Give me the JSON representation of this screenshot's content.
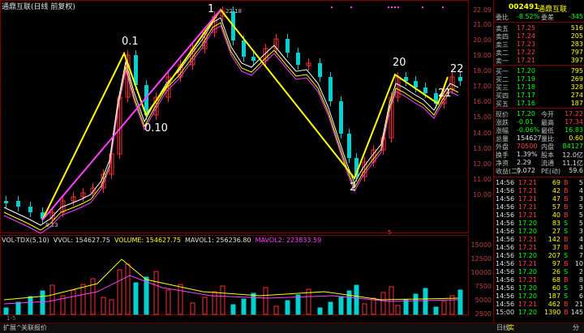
{
  "window": {
    "title": "通鼎互联(日线 前复权)"
  },
  "price_axis": [
    "22.09",
    "21.00",
    "20.00",
    "19.00",
    "18.00",
    "17.00",
    "16.00",
    "15.00",
    "14.00",
    "13.00",
    "12.00",
    "11.00",
    "10.00"
  ],
  "volume_axis": [
    "15000",
    "12500",
    "10000",
    "7500",
    "5000",
    "2500",
    "10000"
  ],
  "waves": [
    {
      "label": "1",
      "name": "wave-1"
    },
    {
      "label": "0.1",
      "name": "wave-0-1"
    },
    {
      "label": "0.10",
      "name": "wave-0-10"
    },
    {
      "label": "2",
      "name": "wave-2"
    },
    {
      "label": "20",
      "name": "wave-20"
    },
    {
      "label": "21",
      "name": "wave-21"
    },
    {
      "label": "22",
      "name": "wave-22"
    }
  ],
  "annotations": {
    "high": "22.18",
    "low": "8.13",
    "low2": "5"
  },
  "volume_legend": {
    "tdx": "VOL-TDX(5,10)",
    "vvol": "VVOL: 154627.75",
    "volume": "VOLUME: 154627.75",
    "mavol1": "MAVOL1: 256236.80",
    "mavol2": "MAVOL2: 223833.59"
  },
  "stock": {
    "code": "002491",
    "name": "通鼎互联"
  },
  "quote": {
    "weibi_label": "委比",
    "weibi": "-8.52%",
    "weicha_label": "委差",
    "weicha": "-345",
    "asks": [
      {
        "label": "卖五",
        "price": "17.25",
        "vol": "516"
      },
      {
        "label": "卖四",
        "price": "17.24",
        "vol": "205"
      },
      {
        "label": "卖三",
        "price": "17.23",
        "vol": "283"
      },
      {
        "label": "卖二",
        "price": "17.22",
        "vol": "797"
      },
      {
        "label": "卖一",
        "price": "17.21",
        "vol": "397"
      }
    ],
    "bids": [
      {
        "label": "买一",
        "price": "17.20",
        "vol": "795"
      },
      {
        "label": "买二",
        "price": "17.19",
        "vol": "269"
      },
      {
        "label": "买三",
        "price": "17.18",
        "vol": "328"
      },
      {
        "label": "买四",
        "price": "17.17",
        "vol": "274"
      },
      {
        "label": "买五",
        "price": "17.16",
        "vol": "187"
      }
    ],
    "stats": [
      {
        "l1": "现价",
        "v1": "17.20",
        "l2": "今开",
        "v2": "17.22",
        "c1": "green",
        "c2": "red"
      },
      {
        "l1": "涨跌",
        "v1": "-0.01",
        "l2": "最高",
        "v2": "17.34",
        "c1": "green",
        "c2": "red"
      },
      {
        "l1": "涨幅",
        "v1": "-0.06%",
        "l2": "最低",
        "v2": "16.83",
        "c1": "green",
        "c2": "green"
      },
      {
        "l1": "总量",
        "v1": "154627",
        "l2": "量比",
        "v2": "0.60",
        "c1": "white",
        "c2": "yellow"
      },
      {
        "l1": "外盘",
        "v1": "70500",
        "l2": "内盘",
        "v2": "84127",
        "c1": "red",
        "c2": "green"
      },
      {
        "l1": "换手",
        "v1": "1.39%",
        "l2": "股本",
        "v2": "12.0亿",
        "c1": "white",
        "c2": "white"
      },
      {
        "l1": "净资",
        "v1": "2.29",
        "l2": "流通",
        "v2": "11.1亿",
        "c1": "white",
        "c2": "white"
      },
      {
        "l1": "收益(二)",
        "v1": "0.072",
        "l2": "PE(动)",
        "v2": "59.6",
        "c1": "white",
        "c2": "white"
      }
    ]
  },
  "ticks": [
    {
      "time": "14:56",
      "price": "17.21",
      "vol": "69",
      "side": "B",
      "n": "5",
      "pc": "red"
    },
    {
      "time": "14:56",
      "price": "17.21",
      "vol": "42",
      "side": "B",
      "n": "4",
      "pc": "red"
    },
    {
      "time": "14:56",
      "price": "17.21",
      "vol": "47",
      "side": "B",
      "n": "3",
      "pc": "red"
    },
    {
      "time": "14:56",
      "price": "17.21",
      "vol": "57",
      "side": "B",
      "n": "5",
      "pc": "red"
    },
    {
      "time": "14:56",
      "price": "17.21",
      "vol": "40",
      "side": "B",
      "n": "5",
      "pc": "red"
    },
    {
      "time": "14:56",
      "price": "17.20",
      "vol": "83",
      "side": "S",
      "n": "5",
      "pc": "green"
    },
    {
      "time": "14:56",
      "price": "17.20",
      "vol": "27",
      "side": "S",
      "n": "3",
      "pc": "green"
    },
    {
      "time": "14:56",
      "price": "17.21",
      "vol": "142",
      "side": "B",
      "n": "4",
      "pc": "red"
    },
    {
      "time": "14:56",
      "price": "17.21",
      "vol": "37",
      "side": "B",
      "n": "4",
      "pc": "red"
    },
    {
      "time": "14:56",
      "price": "17.20",
      "vol": "207",
      "side": "S",
      "n": "7",
      "pc": "green"
    },
    {
      "time": "14:56",
      "price": "17.21",
      "vol": "97",
      "side": "B",
      "n": "10",
      "pc": "red"
    },
    {
      "time": "14:56",
      "price": "17.20",
      "vol": "26",
      "side": "S",
      "n": "2",
      "pc": "green"
    },
    {
      "time": "14:56",
      "price": "17.21",
      "vol": "68",
      "side": "B",
      "n": "8",
      "pc": "red"
    },
    {
      "time": "14:56",
      "price": "17.20",
      "vol": "60",
      "side": "S",
      "n": "3",
      "pc": "green"
    },
    {
      "time": "14:56",
      "price": "17.20",
      "vol": "187",
      "side": "S",
      "n": "6",
      "pc": "green"
    },
    {
      "time": "14:56",
      "price": "17.21",
      "vol": "462",
      "side": "B",
      "n": "21",
      "pc": "red"
    },
    {
      "time": "15:00",
      "price": "17.20",
      "vol": "1390",
      "side": "B",
      "n": "145",
      "pc": "green"
    }
  ],
  "bottom": {
    "tab1": "扩展^",
    "tab2": "关联报价",
    "tab3": "日线",
    "tab4": "实",
    "tab5": "分"
  }
}
